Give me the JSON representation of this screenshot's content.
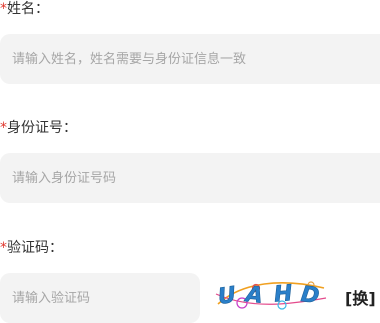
{
  "form": {
    "required_mark": "*",
    "name": {
      "label": "姓名：",
      "placeholder": "请输入姓名，姓名需要与身份证信息一致",
      "value": ""
    },
    "id_number": {
      "label": "身份证号：",
      "placeholder": "请输入身份证号码",
      "value": ""
    },
    "verification": {
      "label": "验证码：",
      "placeholder": "请输入验证码",
      "value": "",
      "captcha_text": "UAHD",
      "refresh_label": "[换]"
    }
  },
  "colors": {
    "required": "#e0362c",
    "field_bg": "#f3f3f3",
    "placeholder": "#a6a6a6",
    "captcha_ink": "#2a7fc9"
  }
}
